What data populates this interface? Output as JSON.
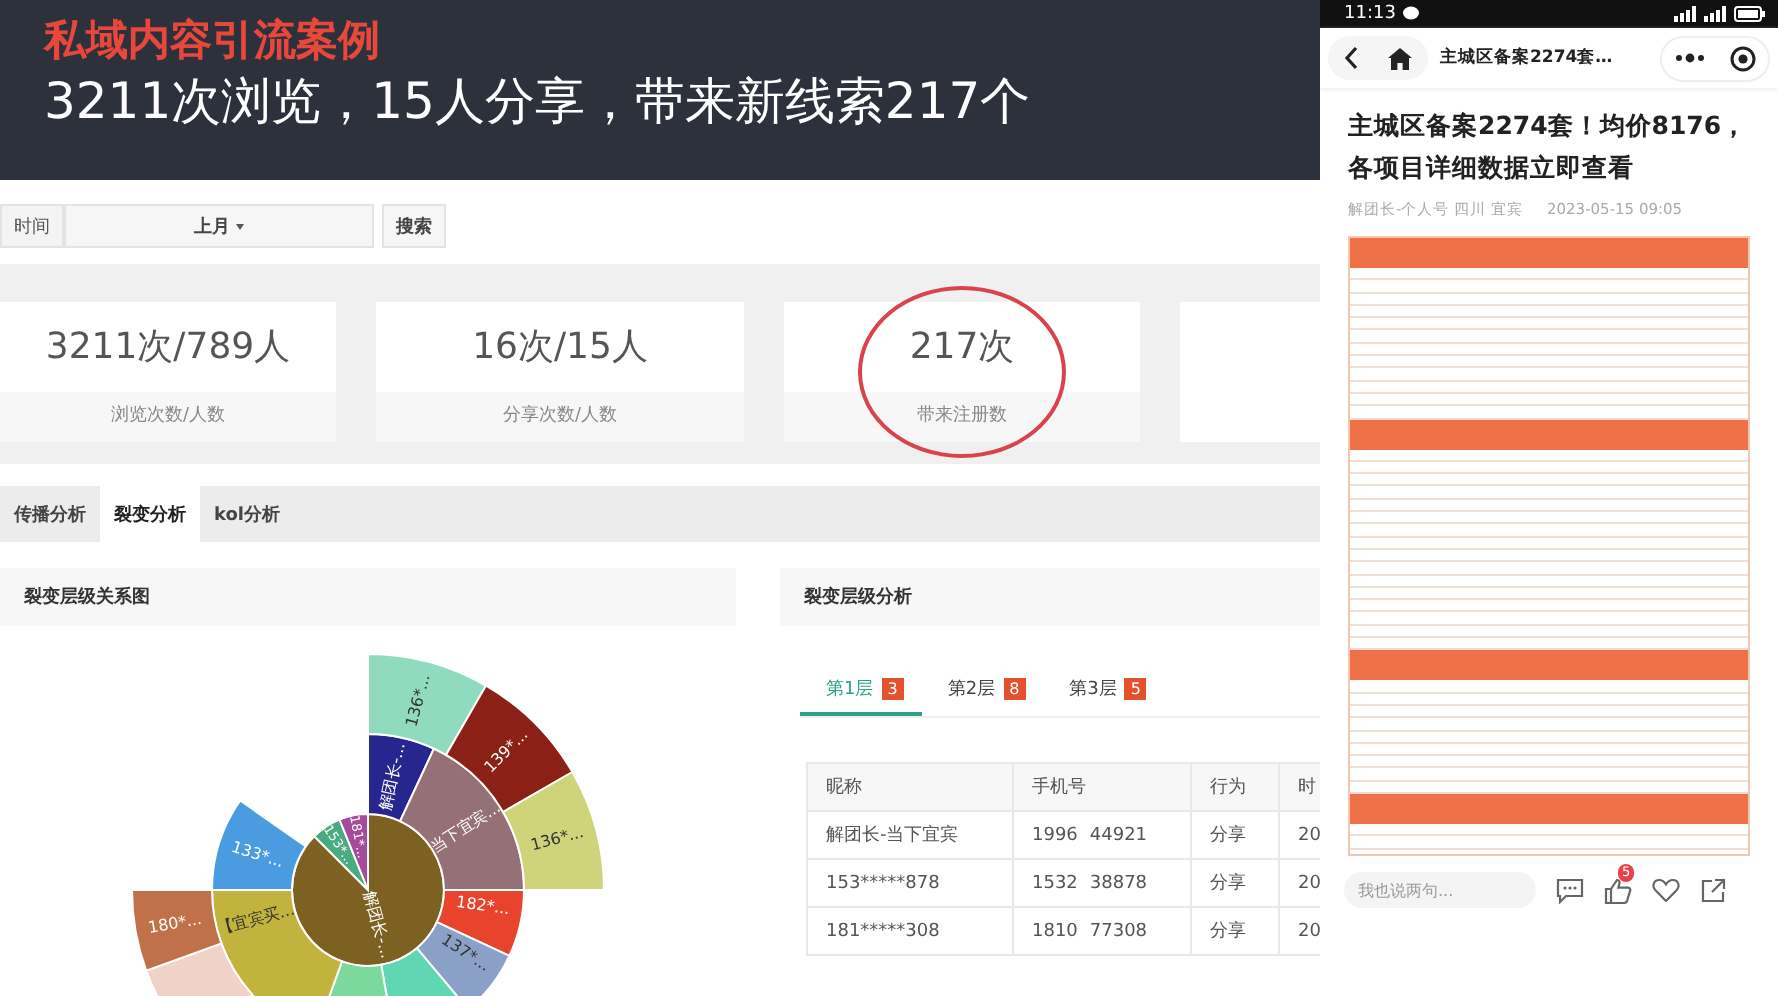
{
  "slide": {
    "title": "私域内容引流案例",
    "subtitle": "3211次浏览，15人分享，带来新线索217个"
  },
  "filter": {
    "label": "时间",
    "dropdown": "上月",
    "button": "搜索"
  },
  "stats": [
    {
      "value": "3211次/789人",
      "label": "浏览次数/人数",
      "circled": false
    },
    {
      "value": "16次/15人",
      "label": "分享次数/人数",
      "circled": false
    },
    {
      "value": "217次",
      "label": "带来注册数",
      "circled": true
    }
  ],
  "tabs": [
    {
      "label": "传播分析",
      "selected": false
    },
    {
      "label": "裂变分析",
      "selected": true
    },
    {
      "label": "kol分析",
      "selected": false
    }
  ],
  "left_panel": {
    "title": "裂变层级关系图",
    "segments": [
      {
        "label": "解团长-...",
        "color": "#7d6122"
      },
      {
        "label": "153*...",
        "color": "#4aaa82"
      },
      {
        "label": "181*...",
        "color": "#a64a9c"
      },
      {
        "label": "解团长-...",
        "color": "#27258e"
      },
      {
        "label": "当下宜宾...",
        "color": "#957177"
      },
      {
        "label": "182*...",
        "color": "#e8432d"
      },
      {
        "label": "137*...",
        "color": "#8aa0c6"
      },
      {
        "color": "#60d6b2"
      },
      {
        "color": "#7bd99e"
      },
      {
        "label": "【宜宾买...",
        "color": "#c2b23e"
      },
      {
        "label": "133*...",
        "color": "#4b9be0"
      },
      {
        "label": "136*...",
        "color": "#90dbbf"
      },
      {
        "label": "139*...",
        "color": "#8b2116"
      },
      {
        "label": "136*...",
        "color": "#cfd47b"
      },
      {
        "color": "#f0d2c8"
      },
      {
        "label": "180*...",
        "color": "#c0714a"
      }
    ]
  },
  "right_panel": {
    "title": "裂变层级分析",
    "layers": [
      {
        "label": "第1层",
        "count": "3",
        "selected": true
      },
      {
        "label": "第2层",
        "count": "8",
        "selected": false
      },
      {
        "label": "第3层",
        "count": "5",
        "selected": false
      }
    ],
    "columns": [
      "昵称",
      "手机号",
      "行为",
      "时"
    ],
    "rows": [
      {
        "nickname": "解团长-当下宜宾",
        "phone_start": "1996",
        "phone_end": "44921",
        "action": "分享",
        "time": "20"
      },
      {
        "nickname": "153*****878",
        "phone_start": "1532",
        "phone_end": "38878",
        "action": "分享",
        "time": "20"
      },
      {
        "nickname": "181*****308",
        "phone_start": "1810",
        "phone_end": "77308",
        "action": "分享",
        "time": "20"
      }
    ]
  },
  "phone": {
    "time": "11:13",
    "nav_title": "主城区备案2274套…",
    "article_title": "主城区备案2274套！均价8176，各项目详细数据立即查看",
    "author": "解团长-个人号 四川 宜宾",
    "date": "2023-05-15 09:05",
    "comment_placeholder": "我也说两句...",
    "like_count": "5"
  }
}
